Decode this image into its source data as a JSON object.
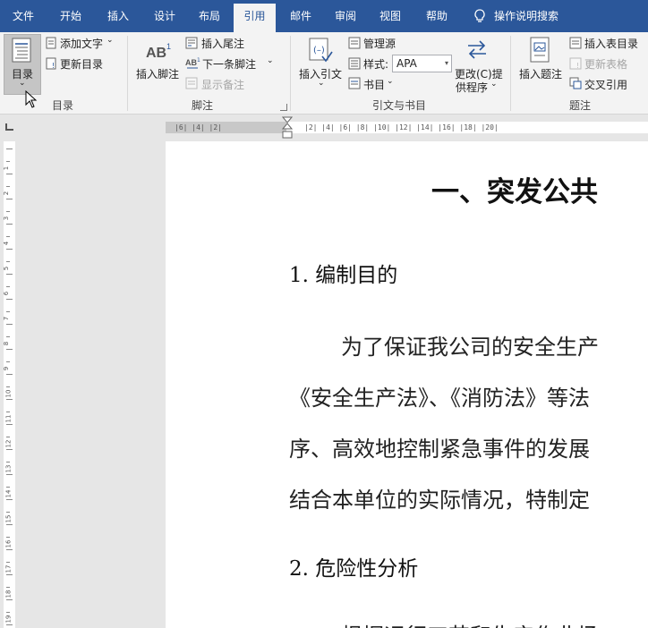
{
  "tabs": [
    "文件",
    "开始",
    "插入",
    "设计",
    "布局",
    "引用",
    "邮件",
    "审阅",
    "视图",
    "帮助"
  ],
  "active_tab": "引用",
  "tell_me": "操作说明搜索",
  "ribbon": {
    "toc": {
      "button": "目录",
      "add_text": "添加文字",
      "update_toc": "更新目录",
      "group": "目录"
    },
    "footnotes": {
      "insert_footnote": "插入脚注",
      "insert_endnote": "插入尾注",
      "next_footnote": "下一条脚注",
      "show_notes": "显示备注",
      "group": "脚注"
    },
    "citations": {
      "insert_citation": "插入引文",
      "manage_sources": "管理源",
      "style_label": "样式:",
      "style_value": "APA",
      "bibliography": "书目",
      "update_line1": "更改(C)提",
      "update_line2": "供程序",
      "group": "引文与书目"
    },
    "captions": {
      "insert_caption": "插入题注",
      "insert_table_of_figures": "插入表目录",
      "update_table": "更新表格",
      "cross_reference": "交叉引用",
      "group": "题注"
    }
  },
  "ruler": {
    "left_numbers": "|6| |4| |2| ",
    "right_numbers": "|2| |4| |6| |8| |10| |12| |14| |16| |18| |20|"
  },
  "document": {
    "title": "一、突发公共",
    "section1": "1. 编制目的",
    "para_lines": [
      "为了保证我公司的安全生产",
      "《安全生产法》、《消防法》等法",
      "序、高效地控制紧急事件的发展",
      "结合本单位的实际情况，特制定"
    ],
    "section2": "2. 危险性分析",
    "partial_line": "根据运行工艺和生产作业场"
  }
}
